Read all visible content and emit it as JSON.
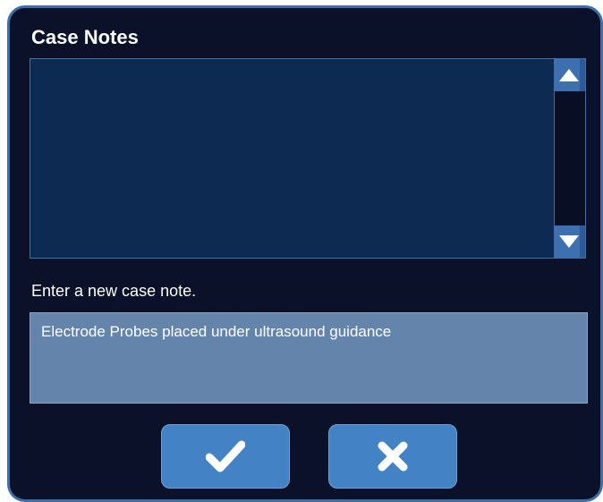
{
  "dialog": {
    "title": "Case Notes",
    "notes_text": "",
    "prompt": "Enter a new case note.",
    "entry_value": "Electrode Probes placed under ultrasound guidance"
  },
  "icons": {
    "scroll_up": "triangle-up-icon",
    "scroll_down": "triangle-down-icon",
    "confirm": "checkmark-icon",
    "cancel": "x-icon"
  },
  "colors": {
    "dialog_background": "#0a1128",
    "dialog_border": "#3d6fa6",
    "notes_background": "#0c2a52",
    "entry_background": "#6584ab",
    "button_background": "#4383c5"
  }
}
